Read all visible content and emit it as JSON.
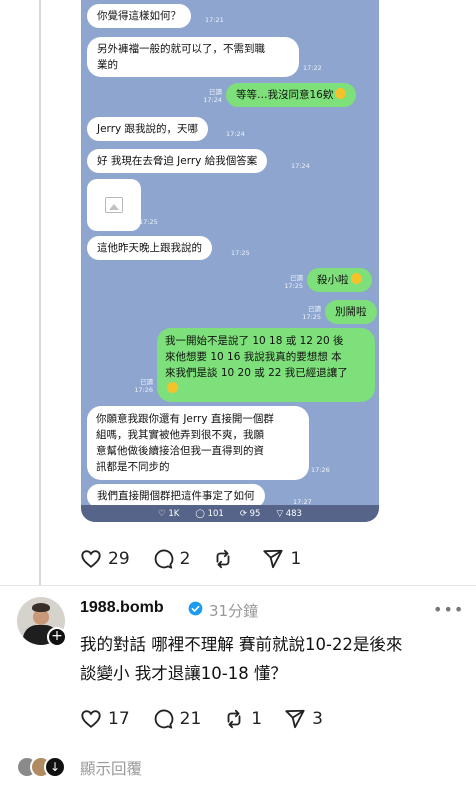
{
  "chat": {
    "messages": [
      {
        "side": "left",
        "text": "你覺得這樣如何？",
        "time": "17:21"
      },
      {
        "side": "left",
        "line1": "另外褲襠一般的就可以了，不需到職",
        "line2": "業的",
        "time": "17:22"
      },
      {
        "side": "right",
        "text": "等等…我沒同意16欸",
        "read": "已讀",
        "time": "17:24"
      },
      {
        "side": "left",
        "text": "Jerry 跟我說的，天哪",
        "time": "17:24"
      },
      {
        "side": "left",
        "text": "好 我現在去脅迫 Jerry 給我個答案",
        "time": "17:24"
      },
      {
        "side": "left",
        "image": true,
        "time": "17:25"
      },
      {
        "side": "left",
        "text": "這他昨天晚上跟我說的",
        "time": "17:25"
      },
      {
        "side": "right",
        "text": "殺小啦",
        "read": "已讀",
        "time": "17:25"
      },
      {
        "side": "right",
        "text": "別鬧啦",
        "read": "已讀",
        "time": "17:25"
      },
      {
        "side": "right",
        "line1": "我一開始不是說了 10 18 或 12 20 後",
        "line2": "來他想要 10 16 我說我真的要想想 本",
        "line3": "來我們是談 10 20 或 22 我已經退讓了",
        "read": "已讀",
        "time": "17:26"
      },
      {
        "side": "left",
        "line1": "你願意我跟你還有 Jerry 直接開一個群",
        "line2": "組嗎，我其實被他弄到很不爽，我願",
        "line3": "意幫他做後續接洽但我一直得到的資",
        "line4": "訊都是不同步的",
        "time": "17:26"
      },
      {
        "side": "left",
        "text": "我們直接開個群把這件事定了如何",
        "time": "17:27"
      }
    ],
    "stats": {
      "likes": "1K",
      "comments": "101",
      "reposts": "95",
      "shares": "483"
    }
  },
  "post_actions": {
    "likes": "29",
    "comments": "2",
    "shares": "1"
  },
  "reply": {
    "username": "1988.bomb",
    "time_ago": "31分鐘",
    "line1": "我的對話 哪裡不理解 賽前就說10-22是後來",
    "line2": "談變小 我才退讓10-18 懂？",
    "actions": {
      "likes": "17",
      "comments": "21",
      "reposts": "1",
      "shares": "3"
    }
  },
  "show_replies": "顯示回覆",
  "colors": {
    "chat_bg": "#8ea6cf",
    "bubble_right": "#7ee07a",
    "verified": "#1d9bf0"
  }
}
